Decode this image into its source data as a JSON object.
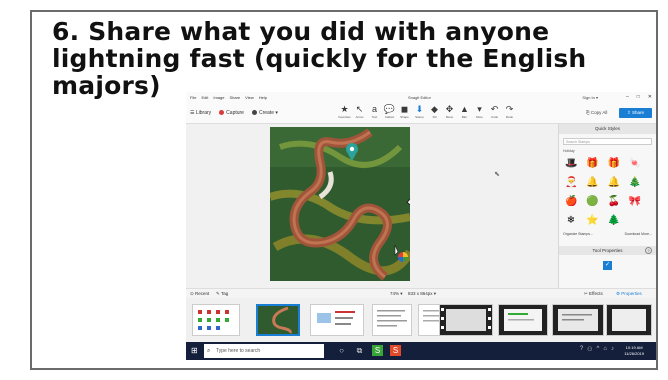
{
  "slide": {
    "title": "6. Share what you did with anyone lightning fast (quickly for the English majors)"
  },
  "app": {
    "window_title": "Snagit Editor",
    "menu": [
      "File",
      "Edit",
      "Image",
      "Share",
      "View",
      "Help"
    ],
    "sign_in": "Sign In ▾",
    "library_label": "Library",
    "capture_label": "Capture",
    "create_label": "Create ▾",
    "tools": [
      {
        "label": "Favorites",
        "glyph": "★"
      },
      {
        "label": "Arrow",
        "glyph": "↖"
      },
      {
        "label": "Text",
        "glyph": "a"
      },
      {
        "label": "Callout",
        "glyph": "💬"
      },
      {
        "label": "Shape",
        "glyph": "◼"
      },
      {
        "label": "Stamp",
        "glyph": "⬇"
      },
      {
        "label": "Fill",
        "glyph": "◆"
      },
      {
        "label": "Move",
        "glyph": "✥"
      },
      {
        "label": "Blur",
        "glyph": "▲"
      },
      {
        "label": "More",
        "glyph": "▾"
      },
      {
        "label": "Undo",
        "glyph": "↶"
      },
      {
        "label": "Redo",
        "glyph": "↷"
      }
    ],
    "copy_all": "Copy All",
    "share_label": "Share",
    "quick_styles": {
      "header": "Quick Styles",
      "search_placeholder": "Search Stamps",
      "category": "Holiday",
      "items": [
        "🎩",
        "🎁",
        "🎁",
        "🍬",
        "🎅",
        "🔔",
        "🔔",
        "🎄",
        "🍎",
        "🟢",
        "🍒",
        "🎀",
        "❄",
        "⭐",
        "🌲",
        ""
      ],
      "organize": "Organize Stamps...",
      "download": "Download More..."
    },
    "tool_properties": "Tool Properties",
    "tray": {
      "recent": "Recent",
      "tag": "Tag",
      "zoom": "74% ▾",
      "size": "833 x 864px ▾",
      "effects": "Effects",
      "properties": "Properties"
    },
    "taskbar": {
      "search_placeholder": "Type here to search",
      "time": "10:19 AM",
      "date": "11/26/2019"
    }
  },
  "colors": {
    "accent": "#1a7fd4",
    "taskbar": "#14203b"
  }
}
